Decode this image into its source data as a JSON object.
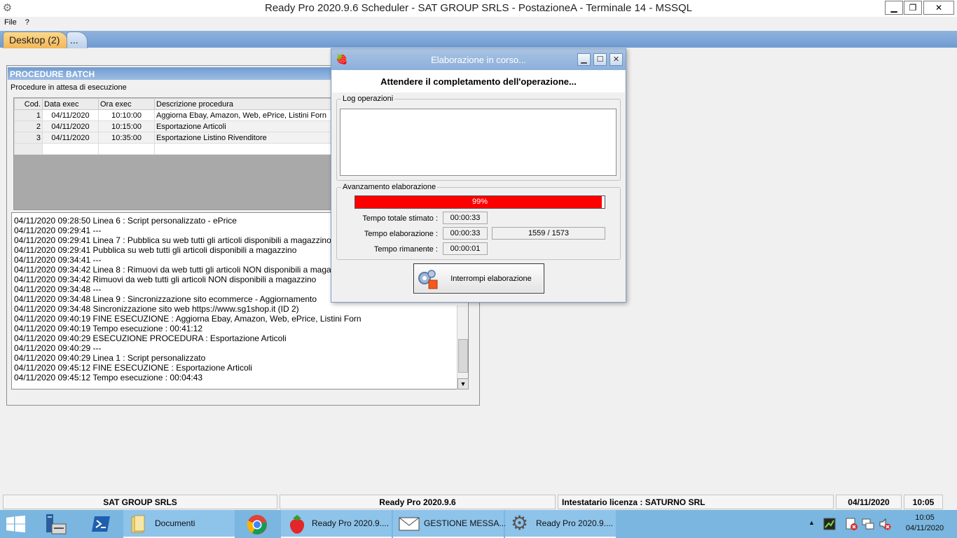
{
  "window": {
    "title": "Ready Pro 2020.9.6 Scheduler  - SAT GROUP SRLS - PostazioneA - Terminale 14 - MSSQL",
    "min_glyph": "▁",
    "max_glyph": "❐",
    "close_glyph": "✕"
  },
  "menu": [
    "File",
    "?"
  ],
  "tabs": {
    "active": "Desktop (2)",
    "more": "..."
  },
  "batch": {
    "header": "PROCEDURE BATCH",
    "subtitle": "Procedure in attesa di esecuzione",
    "columns": [
      "Cod.",
      "Data exec",
      "Ora exec",
      "Descrizione procedura"
    ],
    "rows": [
      {
        "cod": "1",
        "data": "04/11/2020",
        "ora": "10:10:00",
        "desc": "Aggiorna Ebay, Amazon, Web, ePrice, Listini Forn"
      },
      {
        "cod": "2",
        "data": "04/11/2020",
        "ora": "10:15:00",
        "desc": "Esportazione Articoli"
      },
      {
        "cod": "3",
        "data": "04/11/2020",
        "ora": "10:35:00",
        "desc": "Esportazione Listino Rivenditore"
      }
    ],
    "log": [
      "04/11/2020 09:28:50 Linea 6 : Script personalizzato - ePrice",
      "04/11/2020 09:29:41 ---",
      "04/11/2020 09:29:41 Linea 7 : Pubblica su web tutti gli articoli disponibili a magazzino",
      "04/11/2020 09:29:41 Pubblica su web tutti gli articoli disponibili a magazzino",
      "04/11/2020 09:34:41 ---",
      "04/11/2020 09:34:42 Linea 8 : Rimuovi da web tutti gli articoli NON disponibili a magazzino",
      "04/11/2020 09:34:42 Rimuovi da web tutti gli articoli NON disponibili a magazzino",
      "04/11/2020 09:34:48 ---",
      "04/11/2020 09:34:48 Linea 9 : Sincronizzazione sito ecommerce - Aggiornamento",
      "04/11/2020 09:34:48 Sincronizzazione sito web https://www.sg1shop.it (ID 2)",
      "04/11/2020 09:40:19 FINE ESECUZIONE : Aggiorna Ebay, Amazon, Web, ePrice, Listini Forn",
      "04/11/2020 09:40:19 Tempo esecuzione : 00:41:12",
      "04/11/2020 09:40:29 ESECUZIONE PROCEDURA : Esportazione Articoli",
      "04/11/2020 09:40:29 ---",
      "04/11/2020 09:40:29 Linea 1 : Script personalizzato",
      "04/11/2020 09:45:12 FINE ESECUZIONE : Esportazione Articoli",
      "04/11/2020 09:45:12 Tempo esecuzione : 00:04:43"
    ]
  },
  "dialog": {
    "title": "Elaborazione in corso...",
    "wait_text": "Attendere il completamento dell'operazione...",
    "log_group": "Log operazioni",
    "progress_group": "Avanzamento elaborazione",
    "progress_pct_label": "99%",
    "progress_fraction": 0.99,
    "progress_color": "#ff0000",
    "labels": {
      "tempo_totale": "Tempo totale stimato :",
      "tempo_elab": "Tempo elaborazione :",
      "tempo_rim": "Tempo rimanente :"
    },
    "values": {
      "tempo_totale": "00:00:33",
      "tempo_elab": "00:00:33",
      "counter": "1559 / 1573",
      "tempo_rim": "00:00:01"
    },
    "stop_button": "Interrompi elaborazione"
  },
  "statusbar": {
    "company": "SAT GROUP SRLS",
    "version": "Ready Pro 2020.9.6",
    "license": "Intestatario licenza : SATURNO SRL",
    "date": "04/11/2020",
    "time": "10:05"
  },
  "taskbar": {
    "items": [
      "Documenti",
      "Ready Pro 2020.9....",
      "GESTIONE MESSA...",
      "Ready Pro 2020.9...."
    ],
    "clock_time": "10:05",
    "clock_date": "04/11/2020",
    "accent": "#7ab6e0"
  }
}
